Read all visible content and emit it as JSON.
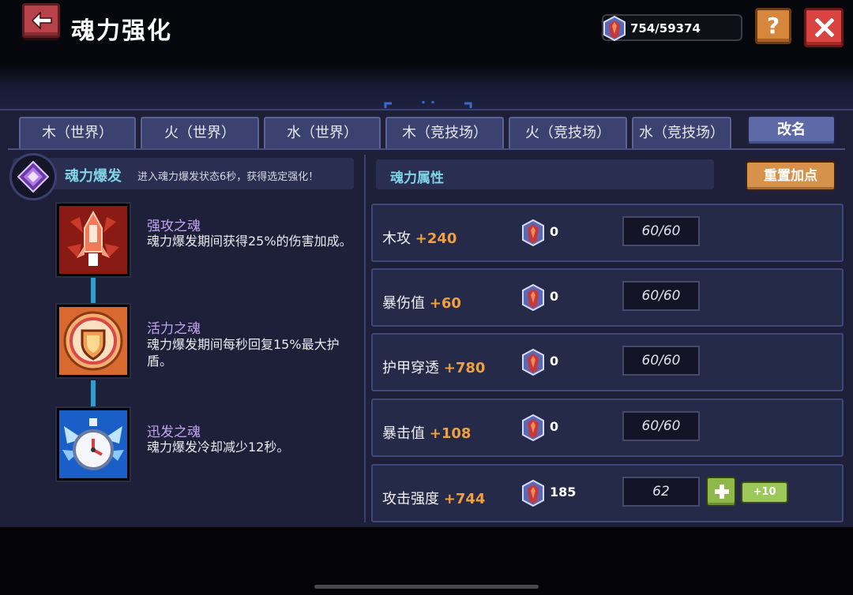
{
  "header": {
    "title": "魂力强化",
    "currency": {
      "icon": "soul-gem-icon",
      "current": "754",
      "max": "59374",
      "display": "754/59374"
    },
    "help_label": "?"
  },
  "tabs": [
    {
      "label": "木（世界）"
    },
    {
      "label": "火（世界）"
    },
    {
      "label": "水（世界）"
    },
    {
      "label": "木（竞技场）"
    },
    {
      "label": "火（竞技场）"
    },
    {
      "label": "水（竞技场）"
    }
  ],
  "rename_label": "改名",
  "reset_label": "重置加点",
  "burst": {
    "title": "魂力爆发",
    "description": "进入魂力爆发状态6秒，获得选定强化！"
  },
  "souls": [
    {
      "name": "强攻之魂",
      "description": "魂力爆发期间获得25%的伤害加成。",
      "icon": "rocket-icon"
    },
    {
      "name": "活力之魂",
      "description": "魂力爆发期间每秒回复15%最大护盾。",
      "icon": "shield-icon"
    },
    {
      "name": "迅发之魂",
      "description": "魂力爆发冷却减少12秒。",
      "icon": "stopwatch-icon"
    }
  ],
  "attributes_title": "魂力属性",
  "attributes": [
    {
      "name": "木攻",
      "bonus": "+240",
      "cost": "0",
      "level": "60/60"
    },
    {
      "name": "暴伤值",
      "bonus": "+60",
      "cost": "0",
      "level": "60/60"
    },
    {
      "name": "护甲穿透",
      "bonus": "+780",
      "cost": "0",
      "level": "60/60"
    },
    {
      "name": "暴击值",
      "bonus": "+108",
      "cost": "0",
      "level": "60/60"
    },
    {
      "name": "攻击强度",
      "bonus": "+744",
      "cost": "185",
      "level": "62",
      "plus10_label": "+10"
    }
  ],
  "colors": {
    "panel": "#1d2038",
    "tab": "#3c4270",
    "accent_cyan": "#7fd4e8",
    "bonus_orange": "#f0a040",
    "soul_name_purple": "#c4a5f4",
    "close_red": "#d94340",
    "help_orange": "#d7873b",
    "plus_green": "#8fb84a"
  }
}
